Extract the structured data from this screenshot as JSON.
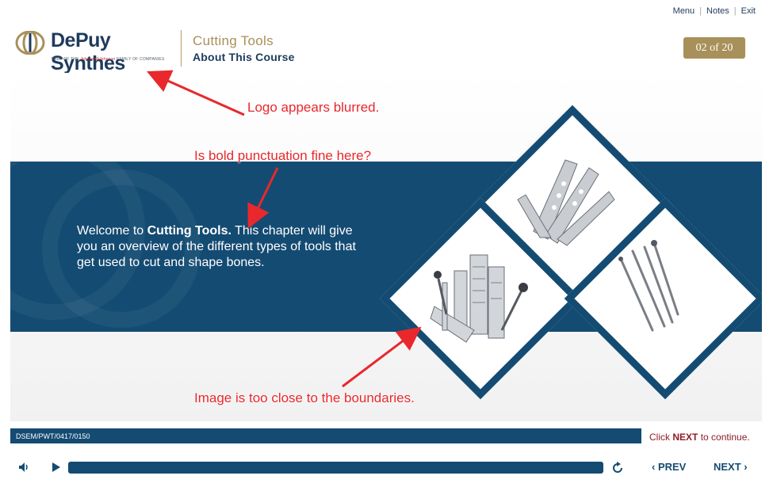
{
  "top_links": {
    "menu": "Menu",
    "notes": "Notes",
    "exit": "Exit",
    "separator": "|"
  },
  "brand": {
    "name": "DePuy Synthes",
    "tagline_prefix": "PART OF THE",
    "tagline_jj": "Johnson&Johnson",
    "tagline_suffix": "FAMILY OF COMPANIES",
    "gold": "#a8905a",
    "navy": "#1e3b5c"
  },
  "course": {
    "title": "Cutting Tools",
    "subtitle": "About This Course"
  },
  "pagination": {
    "label": "02 of 20",
    "current": 2,
    "total": 20
  },
  "content": {
    "welcome_prefix": "Welcome to ",
    "welcome_bold": "Cutting Tools.",
    "welcome_rest": " This chapter will give you an overview of the different types of tools that get used to cut and shape bones."
  },
  "annotations": [
    {
      "text": "Logo appears blurred."
    },
    {
      "text": "Is bold punctuation fine here?"
    },
    {
      "text": "Image is too close to the boundaries."
    }
  ],
  "footer": {
    "code": "DSEM/PWT/0417/0150",
    "continue_prefix": "Click ",
    "continue_bold": "NEXT",
    "continue_suffix": " to continue."
  },
  "controls": {
    "prev_label": "PREV",
    "next_label": "NEXT",
    "volume_icon": "speaker-icon",
    "play_icon": "play-icon",
    "replay_icon": "replay-icon",
    "progress": 0.0
  },
  "colors": {
    "band": "#144b72",
    "annotation": "#e8282c",
    "continue_text": "#8f1d2a"
  }
}
